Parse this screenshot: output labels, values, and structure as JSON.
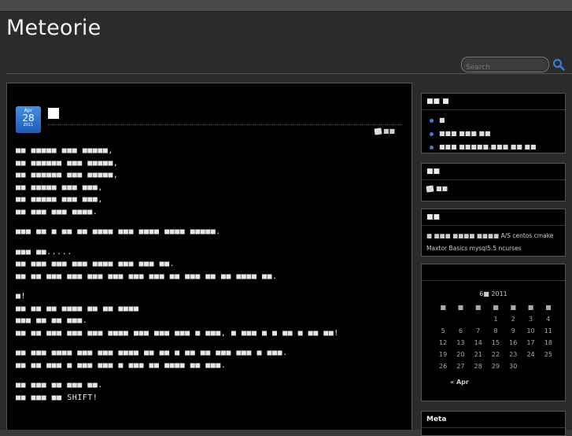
{
  "site": {
    "title": "Meteorie"
  },
  "search": {
    "placeholder": "Search"
  },
  "post": {
    "date": {
      "month": "Apr",
      "day": "28",
      "year": "2011"
    },
    "title": "■",
    "meta": "■■",
    "paragraphs": [
      "■■ ■■■■■ ■■■ ■■■■■,\n■■ ■■■■■■ ■■■ ■■■■■,\n■■ ■■■■■■ ■■■ ■■■■■,\n■■ ■■■■■ ■■■ ■■■,\n■■ ■■■■■ ■■■ ■■■,\n■■ ■■■ ■■■ ■■■■.",
      "■■■ ■■ ■ ■■ ■■ ■■■■ ■■■ ■■■■ ■■■■ ■■■■■.",
      "■■■ ■■.....\n■■ ■■■ ■■■ ■■■ ■■■■ ■■■ ■■■ ■■.\n■■ ■■ ■■■ ■■■ ■■■ ■■■ ■■■ ■■■ ■■ ■■■ ■■ ■■ ■■■■ ■■.",
      "■!\n■■ ■■ ■■ ■■■■ ■■ ■■ ■■■■\n■■■ ■■ ■■ ■■■.\n■■ ■■ ■■■ ■■■ ■■■ ■■■■ ■■■ ■■■ ■■■ ■ ■■■, ■ ■■■ ■ ■ ■■ ■ ■■ ■■!",
      "■■ ■■■ ■■■■ ■■■ ■■■ ■■■■ ■■ ■■ ■ ■■ ■■ ■■■ ■■■ ■ ■■■.\n■■ ■■ ■■■ ■ ■■■ ■■■ ■ ■■■ ■■ ■■■■ ■■ ■■■.",
      "■■ ■■■ ■■ ■■■ ■■.\n■■ ■■■ ■■ SHIFT!"
    ]
  },
  "sidebar": {
    "recent": {
      "title": "■■ ■",
      "items": [
        "■",
        "■■■ ■■■ ■■",
        "■■■ ■■■■■,■■■ ■■ ■■"
      ]
    },
    "categories": {
      "title": "■■",
      "item": "■■"
    },
    "tags": {
      "title": "■■",
      "text": "■ ■■■ ■■■■ ■■■■ A/S centos cmake Maxtor Basics mysql5.5 ncurses"
    },
    "calendar": {
      "caption": "6■ 2011",
      "weekdays": [
        "■",
        "■",
        "■",
        "■",
        "■",
        "■",
        "■"
      ],
      "weeks": [
        [
          "",
          "",
          "",
          "1",
          "2",
          "3",
          "4"
        ],
        [
          "5",
          "6",
          "7",
          "8",
          "9",
          "10",
          "11"
        ],
        [
          "12",
          "13",
          "14",
          "15",
          "16",
          "17",
          "18"
        ],
        [
          "19",
          "20",
          "21",
          "22",
          "23",
          "24",
          "25"
        ],
        [
          "26",
          "27",
          "28",
          "29",
          "30",
          "",
          ""
        ]
      ],
      "prev": "« Apr"
    },
    "meta": {
      "title": "Meta"
    }
  }
}
